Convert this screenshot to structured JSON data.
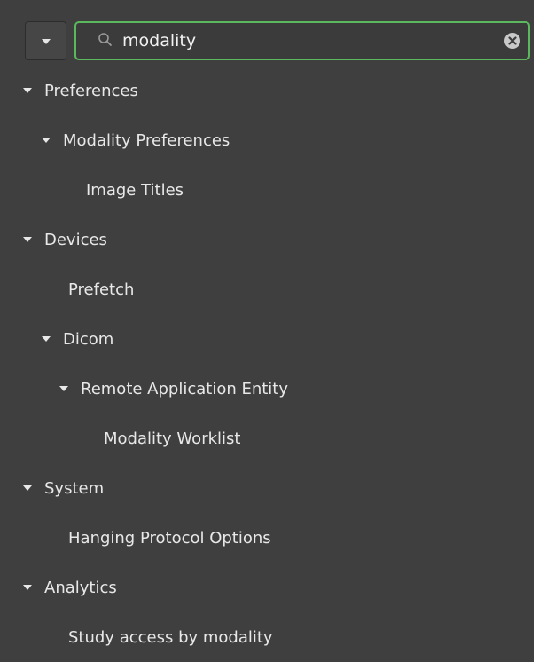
{
  "search": {
    "value": "modality",
    "accent": "#5cb85c"
  },
  "icons": {
    "dropdown": "chevron-down-icon",
    "search": "search-icon",
    "clear": "clear-circle-icon",
    "expanded": "triangle-down-icon"
  },
  "tree": {
    "preferences": "Preferences",
    "modality_preferences": "Modality Preferences",
    "image_titles": "Image Titles",
    "devices": "Devices",
    "prefetch": "Prefetch",
    "dicom": "Dicom",
    "remote_application_entity": "Remote Application Entity",
    "modality_worklist": "Modality Worklist",
    "system": "System",
    "hanging_protocol_options": "Hanging Protocol Options",
    "analytics": "Analytics",
    "study_access_by_modality": "Study access by modality"
  }
}
